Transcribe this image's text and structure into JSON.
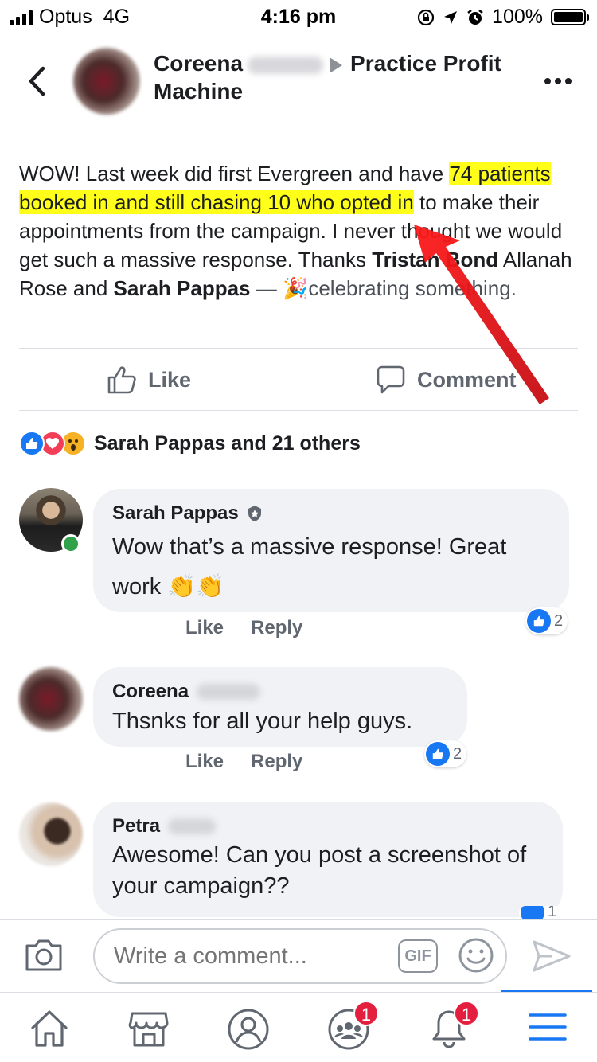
{
  "status_bar": {
    "carrier": "Optus",
    "network": "4G",
    "time": "4:16 pm",
    "battery": "100%"
  },
  "header": {
    "author": "Coreena",
    "group": "Practice Profit Machine",
    "back_icon": "chevron-left-icon",
    "more_icon": "more-horizontal-icon"
  },
  "post": {
    "text_before": "WOW! Last week did first Evergreen and have ",
    "text_highlight": "74 patients booked in and still chasing 10  who opted in",
    "text_mid": " to make their appointments from the campaign. I never thought we would get such a massive response. Thanks ",
    "tag1": "Tristan Bond",
    "text_mid2": " Allanah Rose and ",
    "tag2": "Sarah Pappas",
    "feeling": " — 🎉celebrating something."
  },
  "actions": {
    "like_label": "Like",
    "comment_label": "Comment"
  },
  "reactions": {
    "summary": "Sarah Pappas and 21 others",
    "types": [
      "like",
      "love",
      "wow"
    ]
  },
  "comments": [
    {
      "name": "Sarah Pappas",
      "text": "Wow that’s a massive response! Great work 👏👏",
      "like_label": "Like",
      "reply_label": "Reply",
      "reaction_count": "2"
    },
    {
      "name": "Coreena",
      "text": "Thsnks for all your help guys.",
      "like_label": "Like",
      "reply_label": "Reply",
      "reaction_count": "2"
    },
    {
      "name": "Petra",
      "text": "Awesome! Can you post a screenshot of your campaign??",
      "reaction_count": "1"
    }
  ],
  "composer": {
    "placeholder": "Write a comment...",
    "gif_label": "GIF"
  },
  "tabbar": {
    "groups_badge": "1",
    "notifications_badge": "1"
  },
  "colors": {
    "highlight": "#ffff1a",
    "accent": "#1877f2",
    "badge": "#e41e3f",
    "annotation_arrow": "#e8141b"
  }
}
